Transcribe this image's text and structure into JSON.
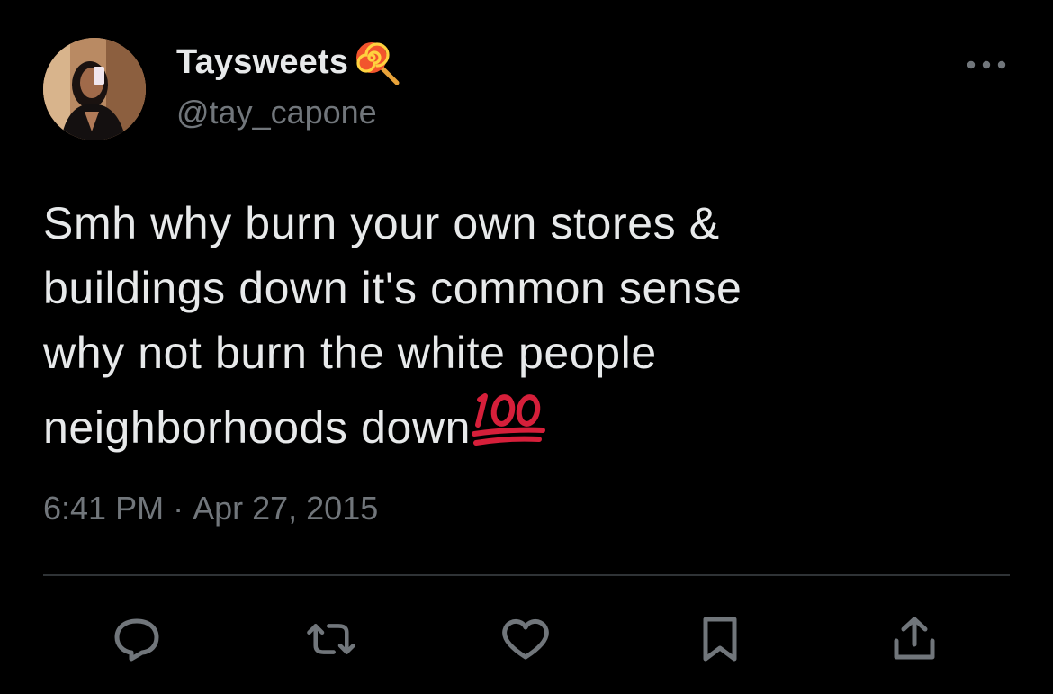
{
  "tweet": {
    "display_name": "Taysweets",
    "name_emoji_icon": "lollipop-icon",
    "handle": "@tay_capone",
    "text": "Smh why burn your own stores &\nbuildings down it's common sense\nwhy not burn the white people\nneighborhoods down",
    "text_emoji_icon": "hundred-points-icon",
    "time": "6:41 PM",
    "separator": "·",
    "date": "Apr 27, 2015"
  },
  "actions": [
    {
      "icon": "reply-icon"
    },
    {
      "icon": "retweet-icon"
    },
    {
      "icon": "like-icon"
    },
    {
      "icon": "bookmark-icon"
    },
    {
      "icon": "share-icon"
    }
  ],
  "colors": {
    "background": "#000000",
    "primary_text": "#e7e9ea",
    "secondary_text": "#71767b",
    "divider": "#2f3336",
    "hundred_red": "#d61f3a"
  }
}
